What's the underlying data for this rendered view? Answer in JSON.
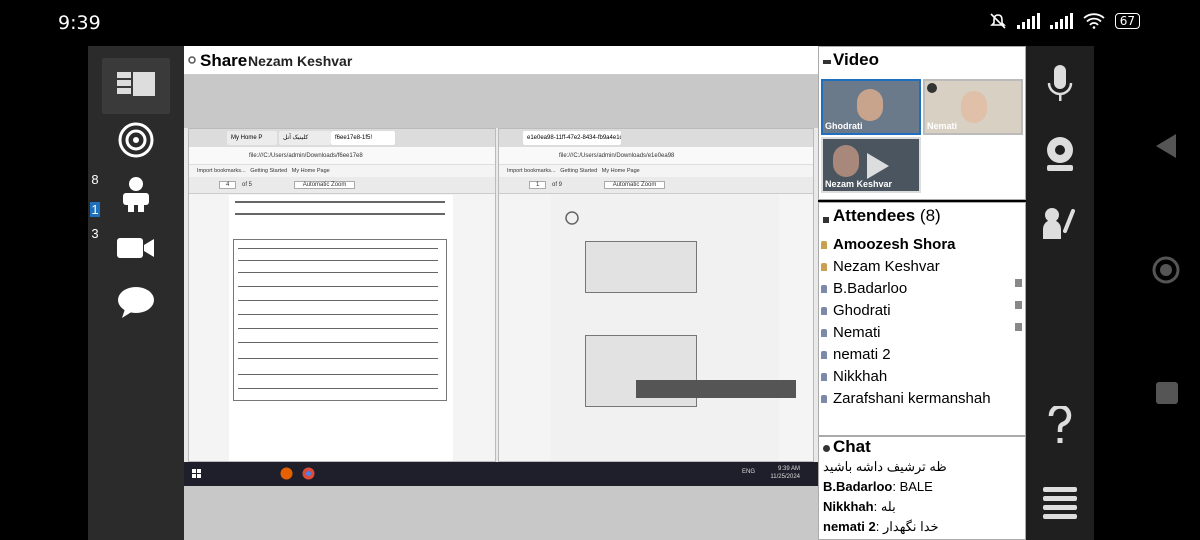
{
  "status": {
    "time": "9:39",
    "battery": "67"
  },
  "left_toolbar": {
    "badges": [
      "8",
      "1",
      "3"
    ]
  },
  "share": {
    "title": "Share",
    "presenter": "Nezam Keshvar"
  },
  "screen": {
    "left_window": {
      "tabs": [
        "My Home P",
        "کلینیک آنل",
        "f6ee17e8-1f5!"
      ],
      "url": "file:///C:/Users/admin/Downloads/f6ee17e8",
      "bookmarks": [
        "Import bookmarks...",
        "Getting Started",
        "My Home Page"
      ],
      "page_input": "4",
      "page_count": "of 5",
      "zoom": "Automatic Zoom"
    },
    "right_window": {
      "tabs": [
        "e1e0ea98-11ff-47e2-8434-fb9a4e1c"
      ],
      "url": "file:///C:/Users/admin/Downloads/e1e0ea98",
      "bookmarks": [
        "Import bookmarks...",
        "Getting Started",
        "My Home Page"
      ],
      "page_input": "1",
      "page_count": "of 9",
      "zoom": "Automatic Zoom"
    },
    "taskbar": {
      "lang": "ENG",
      "time": "9:39 AM",
      "date": "11/25/2024"
    }
  },
  "video": {
    "title": "Video",
    "tiles": [
      {
        "name": "Ghodrati"
      },
      {
        "name": "Nemati"
      },
      {
        "name": "Nezam Keshvar"
      }
    ]
  },
  "attendees": {
    "title": "Attendees",
    "count": "(8)",
    "list": [
      {
        "name": "Amoozesh Shora",
        "bold": true
      },
      {
        "name": "Nezam Keshvar"
      },
      {
        "name": "B.Badarloo"
      },
      {
        "name": "Ghodrati"
      },
      {
        "name": "Nemati"
      },
      {
        "name": "nemati 2"
      },
      {
        "name": "Nikkhah"
      },
      {
        "name": "Zarafshani kermanshah"
      }
    ]
  },
  "chat": {
    "title": "Chat",
    "messages": [
      {
        "sender": "",
        "text": "ظه ترشیف داشه باشید"
      },
      {
        "sender": "B.Badarloo",
        "text": ": BALE"
      },
      {
        "sender": "Nikkhah",
        "text": ": بله"
      },
      {
        "sender": "nemati 2",
        "text": ": خدا نگهدار"
      }
    ]
  }
}
